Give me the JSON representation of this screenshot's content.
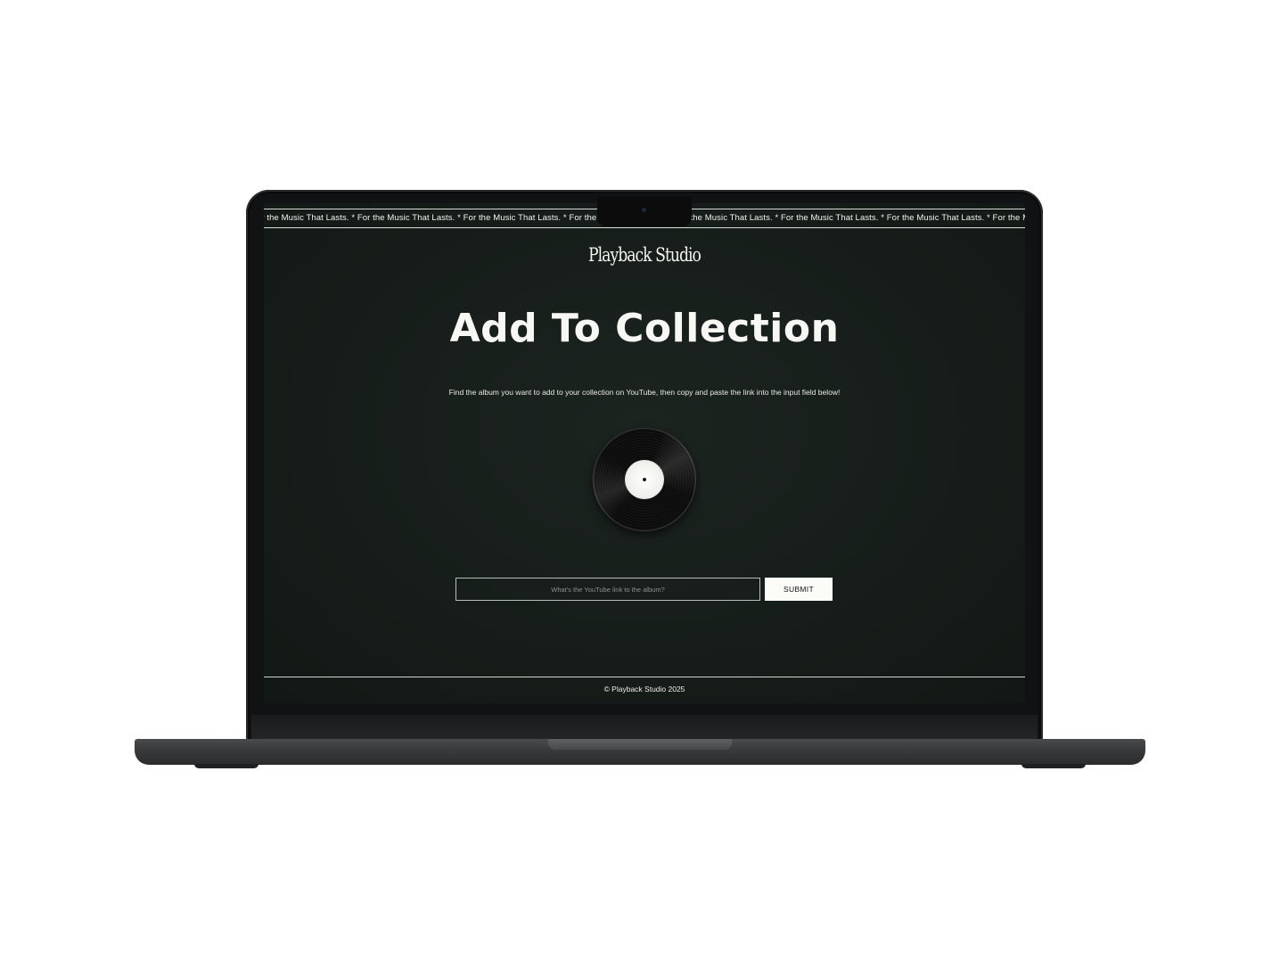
{
  "page": {
    "marquee_text": "or the Music That Lasts. * For the Music That Lasts. * For the Music That Lasts. * For the Music That Lasts. * For the Music That Lasts. * For the Music That Lasts. * For the Music That Lasts. * For the Music That Lasts. * For the Music Th",
    "logo": "Playback Studio",
    "title": "Add To Collection",
    "subtitle": "Find the album you want to add to your collection on YouTube, then copy and paste the link into the input field below!",
    "vinyl_icon": "vinyl-record-icon"
  },
  "form": {
    "input_value": "",
    "input_placeholder": "What's the YouTube link to the album?",
    "submit_label": "SUBMIT"
  },
  "footer": {
    "text": "© Playback Studio 2025"
  },
  "colors": {
    "background": "#161d1a",
    "text": "#f2f2ee",
    "button": "#fbfbf7"
  }
}
